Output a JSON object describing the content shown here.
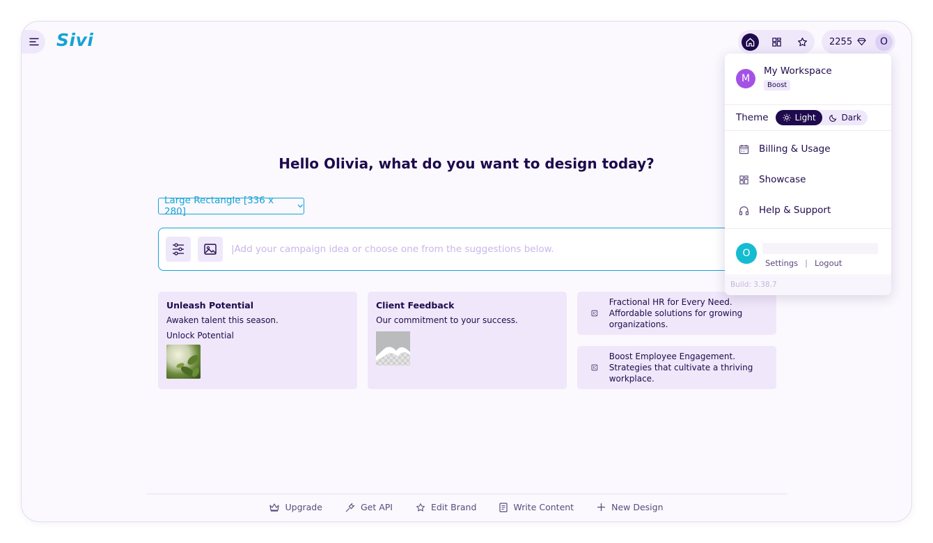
{
  "app": {
    "logo": "Sivi"
  },
  "header": {
    "credits": "2255",
    "user_initial": "O"
  },
  "main": {
    "heading": "Hello Olivia, what do you want to design today?",
    "size_select": {
      "value": "Large Rectangle [336 x 280]"
    },
    "prompt": {
      "placeholder": "|Add your campaign idea or choose one from the suggestions below."
    },
    "suggestions": [
      {
        "title": "Unleash Potential",
        "lines": [
          "Awaken talent this season.",
          "Unlock Potential"
        ]
      },
      {
        "title": "Client Feedback",
        "lines": [
          "Our commitment to your success."
        ]
      },
      {
        "text": "Fractional HR for Every Need. Affordable solutions for growing organizations."
      },
      {
        "text": "Boost Employee Engagement. Strategies that cultivate a thriving workplace."
      }
    ]
  },
  "footer": {
    "items": [
      "Upgrade",
      "Get API",
      "Edit Brand",
      "Write Content",
      "New Design"
    ]
  },
  "dropdown": {
    "workspace": {
      "initial": "M",
      "name": "My Workspace",
      "plan": "Boost"
    },
    "theme": {
      "label": "Theme",
      "light": "Light",
      "dark": "Dark",
      "selected": "Light"
    },
    "menu": [
      "Billing & Usage",
      "Showcase",
      "Help & Support"
    ],
    "user": {
      "initial": "O",
      "settings": "Settings",
      "separator": "|",
      "logout": "Logout"
    },
    "build": "Build: 3.38.7"
  },
  "colors": {
    "accent": "#14a3d6",
    "primary_dark": "#1e0a4c",
    "soft_purple": "#efe8fa",
    "workspace_avatar": "#a452e6",
    "user_avatar": "#14bcd2"
  }
}
